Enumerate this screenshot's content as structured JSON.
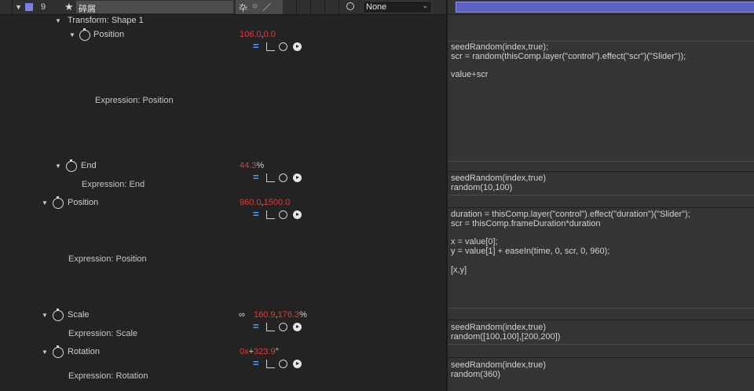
{
  "layer": {
    "index": "9",
    "name": "碎屑",
    "label_color": "#7b7fe6",
    "parent_value": "None"
  },
  "shape_group": {
    "label": "Transform: Shape 1"
  },
  "properties": {
    "shape_position": {
      "name": "Position",
      "v1": "106.0",
      "sep": ",",
      "v2": "0.0",
      "expr_label": "Expression: Position"
    },
    "end": {
      "name": "End",
      "v1": "44.3",
      "unit": "%",
      "expr_label": "Expression: End"
    },
    "position": {
      "name": "Position",
      "v1": "960.0",
      "sep": ",",
      "v2": "1500.0",
      "expr_label": "Expression: Position"
    },
    "scale": {
      "name": "Scale",
      "v1": "160.9",
      "sep": ",",
      "v2": "176.3",
      "unit": "%",
      "expr_label": "Expression: Scale"
    },
    "rotation": {
      "name": "Rotation",
      "v1": "0x",
      "sep": "+",
      "v2": "323.9",
      "unit": "°",
      "expr_label": "Expression: Rotation"
    }
  },
  "expressions": {
    "shape_position": "seedRandom(index,true);\nscr = random(thisComp.layer(\"control\").effect(\"scr\")(\"Slider\"));\n\nvalue+scr",
    "end": "seedRandom(index,true)\nrandom(10,100)",
    "position": "duration = thisComp.layer(\"control\").effect(\"duration\")(\"Slider\");\nscr = thisComp.frameDuration*duration\n\nx = value[0];\ny = value[1] + easeIn(time, 0, scr, 0, 960);\n\n[x,y]",
    "scale": "seedRandom(index,true)\nrandom([100,100],[200,200])",
    "rotation": "seedRandom(index,true)\nrandom(360)"
  },
  "colors": {
    "value_red": "#e23b3b",
    "accent_blue": "#5aa0ff",
    "time_bar": "#5d63c4"
  },
  "icons": [
    "twirl-down-icon",
    "stopwatch-icon",
    "equals-icon",
    "graph-icon",
    "pickwhip-icon",
    "play-icon",
    "link-icon",
    "star-icon",
    "spiral-icon"
  ]
}
